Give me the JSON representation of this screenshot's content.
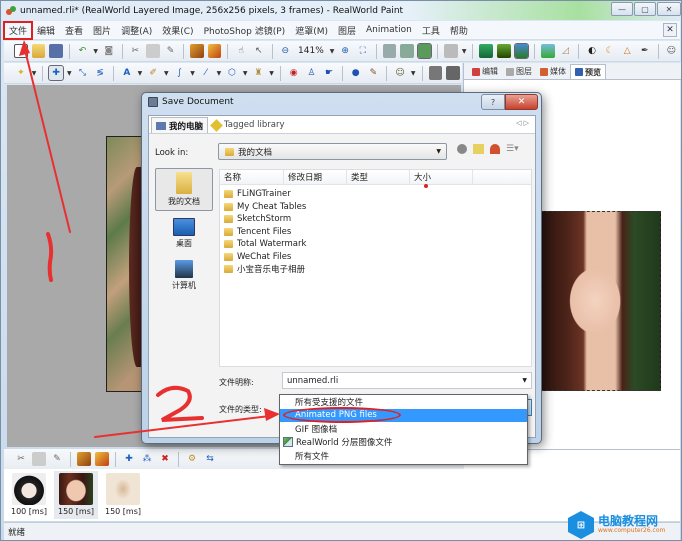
{
  "window": {
    "title": "unnamed.rli* (RealWorld Layered Image, 256x256 pixels, 3 frames) - RealWorld Paint",
    "controls": {
      "minimize": "—",
      "maximize": "▢",
      "close": "✕"
    }
  },
  "menubar": {
    "items": [
      "文件",
      "编辑",
      "查看",
      "图片",
      "调整(A)",
      "效果(C)",
      "PhotoShop 滤镜(P)",
      "遮罩(M)",
      "图层",
      "Animation",
      "工具",
      "帮助"
    ],
    "close": "✕"
  },
  "toolbar": {
    "zoom_value": "141%"
  },
  "right_panel": {
    "tabs": [
      "编辑",
      "图层",
      "媒体",
      "预览"
    ],
    "active_tab": "预览"
  },
  "dialog": {
    "title": "Save Document",
    "help": "?",
    "close": "✕",
    "tabs": [
      "我的电脑",
      "Tagged library"
    ],
    "tab_nav": "◁ ▷",
    "look_in_label": "Look in:",
    "look_in_value": "我的文档",
    "places": [
      "我的文档",
      "桌面",
      "计算机"
    ],
    "columns": [
      "名称",
      "修改日期",
      "类型",
      "大小"
    ],
    "files": [
      "FLiNGTrainer",
      "My Cheat Tables",
      "SketchStorm",
      "Tencent Files",
      "Total Watermark",
      "WeChat Files",
      "小宝音乐电子相册"
    ],
    "filename_label": "文件明称:",
    "filename_value": "unnamed.rli",
    "filetype_label": "文件的类型:",
    "filetype_value": "RealWorld 分层图像文件",
    "filetype_options": [
      "所有受支援的文件",
      "Animated PNG files",
      "GIF 图像档",
      "RealWorld 分层图像文件",
      "所有文件"
    ],
    "filetype_highlighted": "Animated PNG files"
  },
  "frames": [
    {
      "label": "100 [ms]"
    },
    {
      "label": "150 [ms]"
    },
    {
      "label": "150 [ms]"
    }
  ],
  "status": "就绪",
  "annotations": {
    "step1": "1",
    "step2": "2",
    "color": "#e02020"
  },
  "watermark": {
    "title": "电脑教程网",
    "subtitle": "www.computer26.com"
  }
}
